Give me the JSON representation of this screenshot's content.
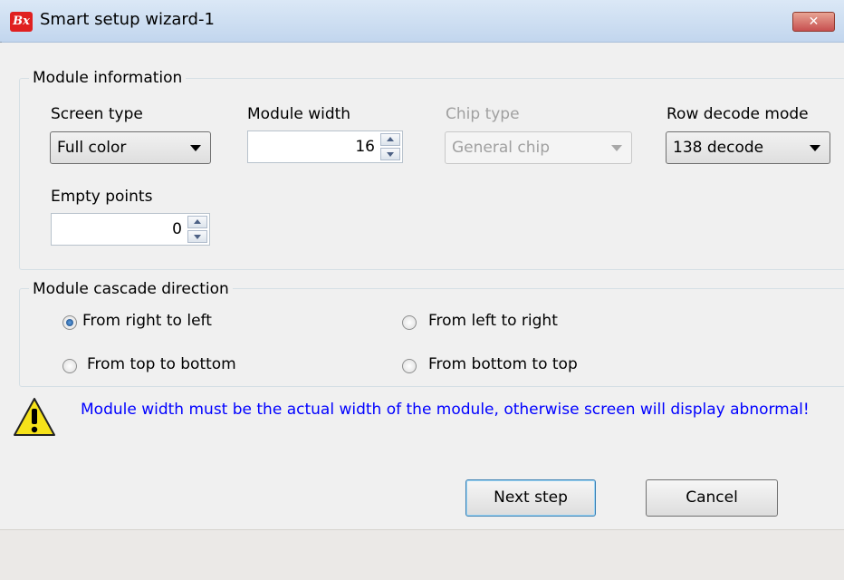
{
  "window": {
    "title": "Smart setup wizard-1",
    "logo_text": "Bx",
    "close_glyph": "✕",
    "icons": {
      "app": "bx-app-logo-icon",
      "close": "close-icon"
    }
  },
  "module_info": {
    "group_label": "Module information",
    "screen_type": {
      "label": "Screen type",
      "value": "Full color"
    },
    "module_width": {
      "label": "Module width",
      "value": "16"
    },
    "chip_type": {
      "label": "Chip type",
      "value": "General chip",
      "disabled": true
    },
    "row_decode_mode": {
      "label": "Row decode mode",
      "value": "138 decode"
    },
    "empty_points": {
      "label": "Empty points",
      "value": "0"
    }
  },
  "cascade": {
    "group_label": "Module cascade direction",
    "options": [
      {
        "label": "From right to left",
        "checked": true
      },
      {
        "label": "From left to right",
        "checked": false
      },
      {
        "label": "From top to bottom",
        "checked": false
      },
      {
        "label": "From bottom to top",
        "checked": false
      }
    ]
  },
  "warning": {
    "icon": "warning-icon",
    "text": "Module width must be the actual width of the module, otherwise screen will display abnormal!"
  },
  "buttons": {
    "next": "Next step",
    "cancel": "Cancel"
  },
  "colors": {
    "warning_text": "#0000ff",
    "title_bar": "#c2d6ee",
    "close_button": "#c75050"
  }
}
